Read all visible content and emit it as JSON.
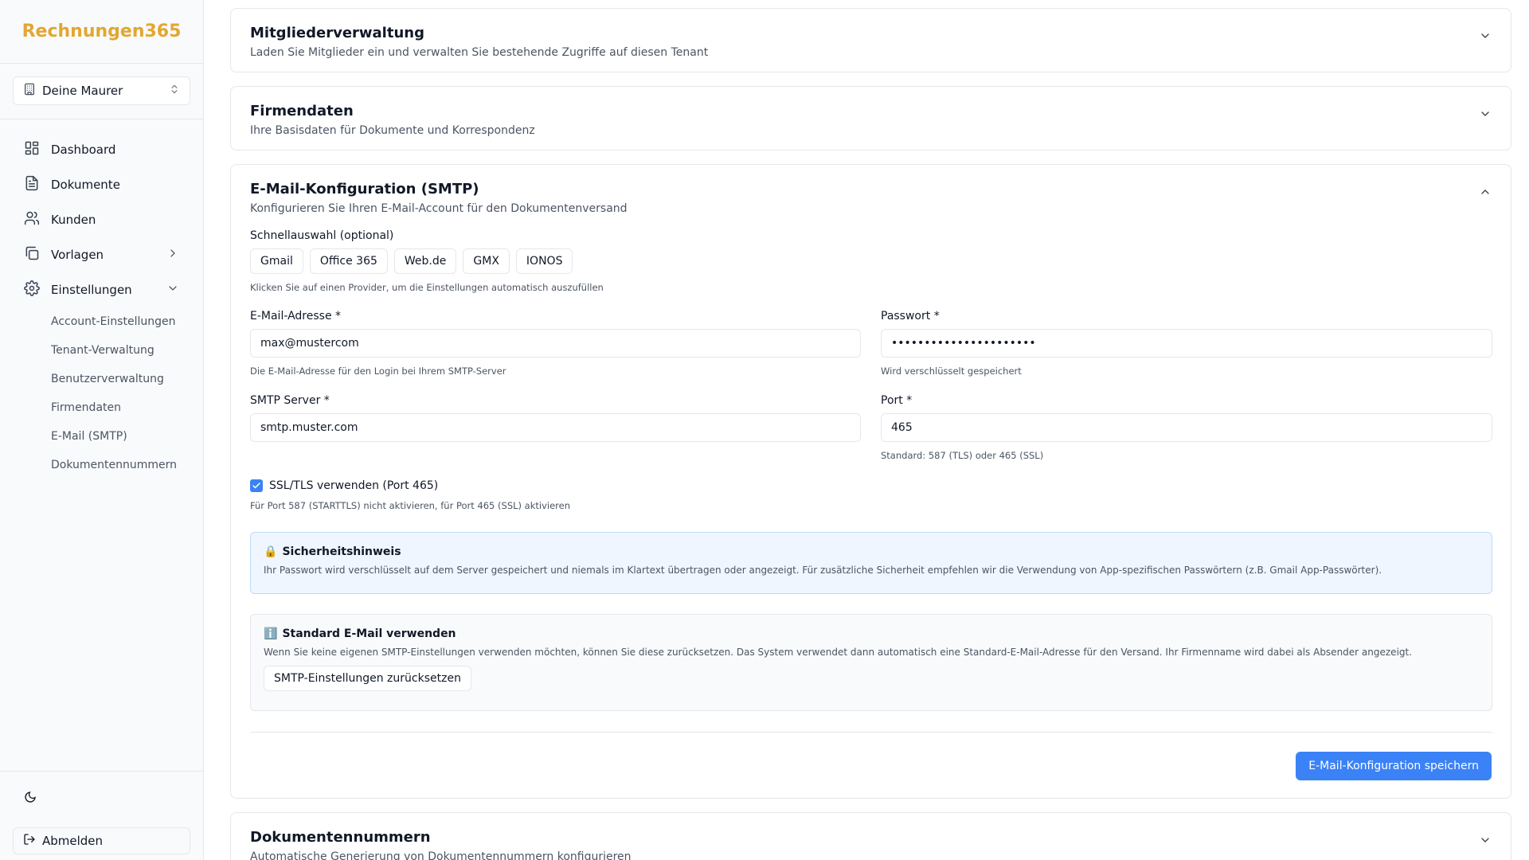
{
  "app": {
    "brand": "Rechnungen365"
  },
  "tenant": {
    "name": "Deine Maurer"
  },
  "nav": {
    "items": [
      {
        "label": "Dashboard"
      },
      {
        "label": "Dokumente"
      },
      {
        "label": "Kunden"
      },
      {
        "label": "Vorlagen"
      },
      {
        "label": "Einstellungen"
      }
    ],
    "settings_sub": [
      "Account-Einstellungen",
      "Tenant-Verwaltung",
      "Benutzerverwaltung",
      "Firmendaten",
      "E-Mail (SMTP)",
      "Dokumentennummern"
    ],
    "logout": "Abmelden"
  },
  "cards": {
    "members": {
      "title": "Mitgliederverwaltung",
      "desc": "Laden Sie Mitglieder ein und verwalten Sie bestehende Zugriffe auf diesen Tenant"
    },
    "company": {
      "title": "Firmendaten",
      "desc": "Ihre Basisdaten für Dokumente und Korrespondenz"
    },
    "smtp": {
      "title": "E-Mail-Konfiguration (SMTP)",
      "desc": "Konfigurieren Sie Ihren E-Mail-Account für den Dokumentenversand",
      "quick_label": "Schnellauswahl (optional)",
      "providers": [
        "Gmail",
        "Office 365",
        "Web.de",
        "GMX",
        "IONOS"
      ],
      "quick_hint": "Klicken Sie auf einen Provider, um die Einstellungen automatisch auszufüllen",
      "email_label": "E-Mail-Adresse *",
      "email_value": "max@mustercom",
      "email_hint": "Die E-Mail-Adresse für den Login bei Ihrem SMTP-Server",
      "password_label": "Passwort *",
      "password_value": "••••••••••••••••••••••",
      "password_hint": "Wird verschlüsselt gespeichert",
      "server_label": "SMTP Server *",
      "server_value": "smtp.muster.com",
      "port_label": "Port *",
      "port_value": "465",
      "port_hint": "Standard: 587 (TLS) oder 465 (SSL)",
      "ssl_label": "SSL/TLS verwenden (Port 465)",
      "ssl_checked": true,
      "ssl_hint": "Für Port 587 (STARTTLS) nicht aktivieren, für Port 465 (SSL) aktivieren",
      "security_title": "Sicherheitshinweis",
      "security_text": "Ihr Passwort wird verschlüsselt auf dem Server gespeichert und niemals im Klartext übertragen oder angezeigt. Für zusätzliche Sicherheit empfehlen wir die Verwendung von App-spezifischen Passwörtern (z.B. Gmail App-Passwörter).",
      "default_title": "Standard E-Mail verwenden",
      "default_text": "Wenn Sie keine eigenen SMTP-Einstellungen verwenden möchten, können Sie diese zurücksetzen. Das System verwendet dann automatisch eine Standard-E-Mail-Adresse für den Versand. Ihr Firmenname wird dabei als Absender angezeigt.",
      "reset_button": "SMTP-Einstellungen zurücksetzen",
      "save_button": "E-Mail-Konfiguration speichern"
    },
    "docnumbers": {
      "title": "Dokumentennummern",
      "desc": "Automatische Generierung von Dokumentennummern konfigurieren"
    }
  },
  "colors": {
    "brand": "#e2a731",
    "primary": "#3b82f6",
    "info_bg": "#eff6ff"
  }
}
